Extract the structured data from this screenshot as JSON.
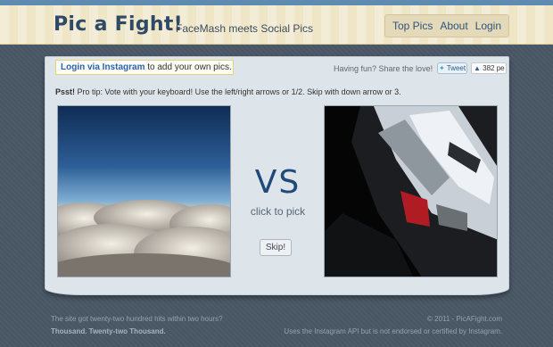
{
  "header": {
    "logo": "Pic a Fight!",
    "tagline": "FaceMash meets Social Pics",
    "nav": [
      {
        "label": "Top Pics"
      },
      {
        "label": "About"
      },
      {
        "label": "Login"
      }
    ]
  },
  "panel": {
    "login_link": "Login via Instagram",
    "login_suffix": " to add your own pics.",
    "share_text": "Having fun? Share the love!",
    "tweet_label": "Tweet",
    "like_count": "382 pe",
    "tip_bold": "Psst!",
    "tip_text": " Pro tip: Vote with your keyboard! Use the left/right arrows or 1/2. Skip with down arrow or 3.",
    "vs": "VS",
    "click_to_pick": "click to pick",
    "skip_label": "Skip!"
  },
  "footer": {
    "left_line1": "The site got twenty-two hundred hits within two hours?",
    "left_line2": "Thousand. Twenty-two Thousand.",
    "right_line1": "© 2011 - PicAFight.com",
    "right_line2": "Uses the Instagram API but is not endorsed or certified by Instagram."
  },
  "icons": {
    "tweet": "bird-icon",
    "like": "thumbs-up-icon"
  },
  "colors": {
    "accent": "#2f4a66",
    "link": "#2d62b0",
    "vs": "#1f4a7a"
  }
}
